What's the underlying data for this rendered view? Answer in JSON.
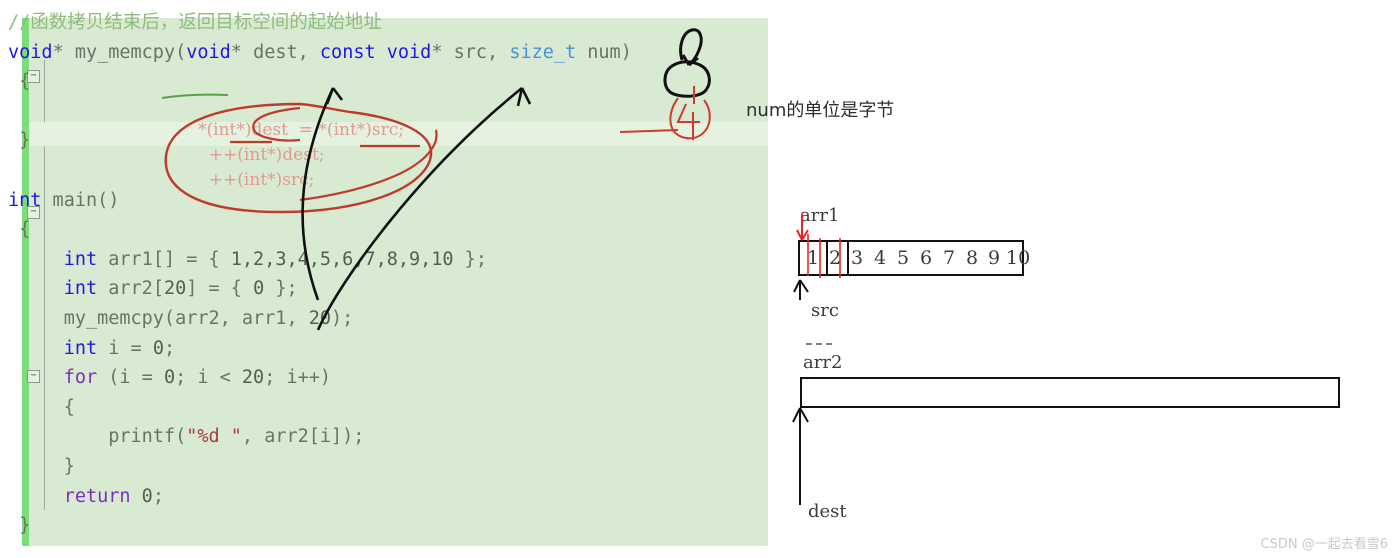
{
  "code_panel": {
    "comment": "//函数拷贝结束后，返回目标空间的起始地址",
    "lines": {
      "signature_ret": "void*",
      "signature_name": " my_memcpy(",
      "p1_type": "void*",
      "p1_name": " dest",
      "p2_const": "const void*",
      "p2_name": " src",
      "p3_type": "size_t",
      "p3_name": " num",
      "paren_close": ")"
    },
    "full_code": "void* my_memcpy(void* dest, const void* src, size_t num)\n{\n\n}\n\nint main()\n{\n    int arr1[] = { 1,2,3,4,5,6,7,8,9,10 };\n    int arr2[20] = { 0 };\n    my_memcpy(arr2, arr1, 20);\n    int i = 0;\n    for (i = 0; i < 20; i++)\n    {\n        printf(\"%d \", arr2[i]);\n    }\n    return 0;\n}",
    "collapse_glyph": "−"
  },
  "annotations": {
    "red_handwritten": "*(int*)dest  = *(int*)src;\n  ++(int*)dest;\n  ++(int*)src;",
    "side_note": "num的单位是字节",
    "red_digit": "4"
  },
  "diagram": {
    "arr1_label": "arr1",
    "arr1_values": [
      "1",
      "2",
      "3",
      "4",
      "5",
      "6",
      "7",
      "8",
      "9",
      "10"
    ],
    "src_label": "src",
    "arr2_label": "arr2",
    "arr2_values": [],
    "dest_label": "dest"
  },
  "watermark": "CSDN @一起去看雪6",
  "colors": {
    "code_bg": "#d9ead3",
    "gutter_green": "#7ddc7a",
    "keyword_blue": "#2018e8",
    "keyword_purple": "#7b2fbe",
    "comment_green": "#8fbb7e",
    "string_red": "#a93b3b",
    "ink_red": "#d1392f",
    "ink_black": "#111111"
  }
}
